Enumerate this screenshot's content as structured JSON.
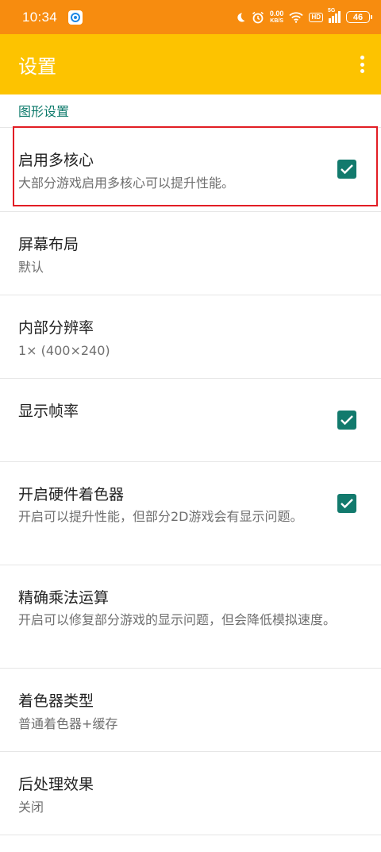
{
  "status_bar": {
    "time": "10:34",
    "net_speed_value": "0.00",
    "net_speed_unit": "KB/S",
    "hd_label": "HD",
    "signal_label": "5G",
    "battery_level": "46",
    "icons": [
      "notification-app-icon",
      "moon-icon",
      "alarm-icon",
      "wifi-icon",
      "signal-icon",
      "battery-icon"
    ]
  },
  "app_bar": {
    "title": "设置",
    "background": "#fdc300"
  },
  "section": {
    "title": "图形设置",
    "accent_color": "#0d7a6b"
  },
  "settings": [
    {
      "title": "启用多核心",
      "summary": "大部分游戏启用多核心可以提升性能。",
      "checkbox": true,
      "checked": true,
      "highlighted": true
    },
    {
      "title": "屏幕布局",
      "summary": "默认",
      "checkbox": false
    },
    {
      "title": "内部分辨率",
      "summary": "1× (400×240)",
      "checkbox": false
    },
    {
      "title": "显示帧率",
      "summary": "",
      "checkbox": true,
      "checked": true
    },
    {
      "title": "开启硬件着色器",
      "summary": "开启可以提升性能，但部分2D游戏会有显示问题。",
      "checkbox": true,
      "checked": true
    },
    {
      "title": "精确乘法运算",
      "summary": "开启可以修复部分游戏的显示问题，但会降低模拟速度。",
      "checkbox": false
    },
    {
      "title": "着色器类型",
      "summary": "普通着色器+缓存",
      "checkbox": false
    },
    {
      "title": "后处理效果",
      "summary": "关闭",
      "checkbox": false
    }
  ],
  "colors": {
    "status_bar": "#f78c0f",
    "checkbox": "#127a6d",
    "highlight_border": "#e21d25"
  }
}
